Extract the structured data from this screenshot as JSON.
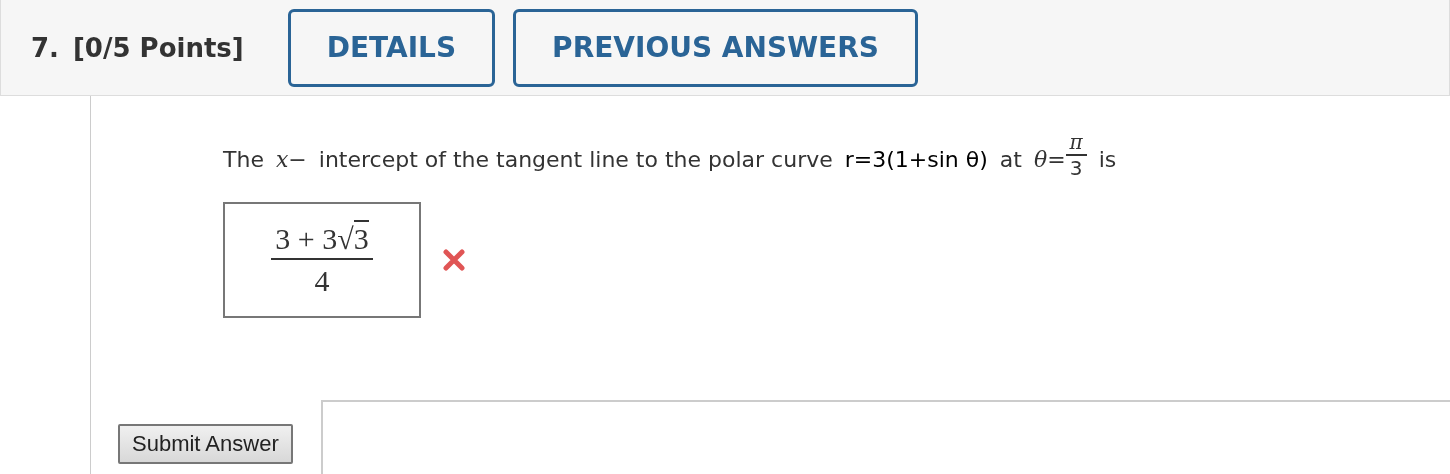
{
  "header": {
    "number": "7.",
    "points": "[0/5 Points]",
    "buttons": [
      "DETAILS",
      "PREVIOUS ANSWERS"
    ]
  },
  "question": {
    "parts": [
      {
        "kind": "text",
        "text": "The"
      },
      {
        "kind": "math",
        "text": "x−"
      },
      {
        "kind": "text",
        "text": "intercept of the tangent line to the polar curve"
      },
      {
        "kind": "expr",
        "text": "r=3(1+sin θ)"
      },
      {
        "kind": "text",
        "text": "at"
      },
      {
        "kind": "math",
        "text": "θ="
      },
      {
        "kind": "fraction",
        "numerator": "π",
        "denominator": "3"
      },
      {
        "kind": "text",
        "text": "is"
      }
    ]
  },
  "answer": {
    "numerator": "3 + 3",
    "radical_sign": "√",
    "radicand": "3",
    "denominator": "4",
    "correct": false
  },
  "submit": {
    "label": "Submit Answer"
  }
}
